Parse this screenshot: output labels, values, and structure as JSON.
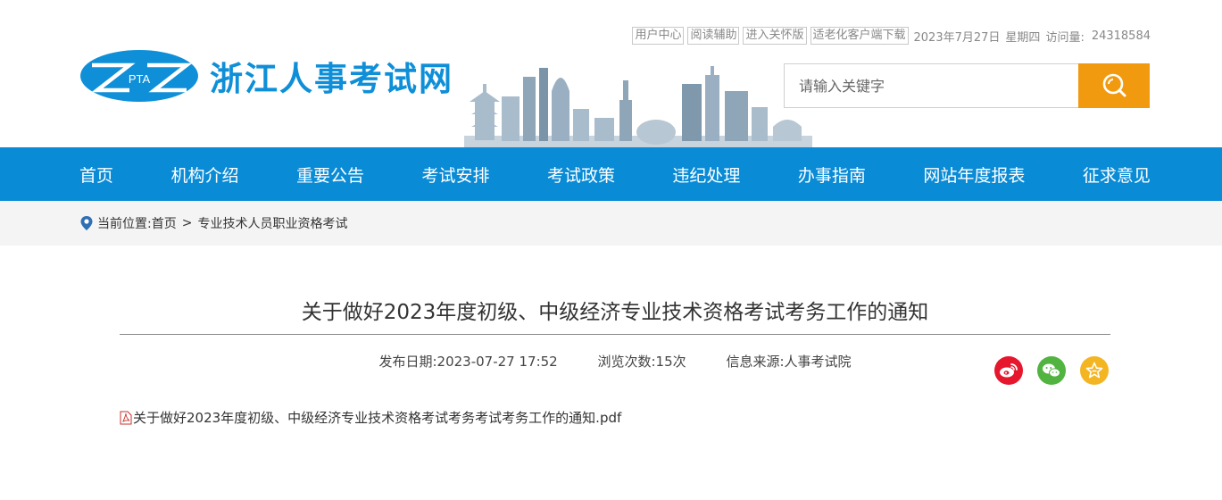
{
  "header": {
    "top_links": [
      "用户中心",
      "阅读辅助",
      "进入关怀版",
      "适老化客户端下载"
    ],
    "date": "2023年7月27日",
    "weekday": "星期四",
    "visit_label": "访问量:",
    "visit_count": "24318584",
    "logo_badge_text": "PTA",
    "site_title": "浙江人事考试网"
  },
  "search": {
    "placeholder": "请输入关键字"
  },
  "nav": {
    "items": [
      "首页",
      "机构介绍",
      "重要公告",
      "考试安排",
      "考试政策",
      "违纪处理",
      "办事指南",
      "网站年度报表",
      "征求意见"
    ]
  },
  "breadcrumb": {
    "label": "当前位置:",
    "home": "首页",
    "separator": ">",
    "current": "专业技术人员职业资格考试"
  },
  "article": {
    "title": "关于做好2023年度初级、中级经济专业技术资格考试考务工作的通知",
    "publish_date": "发布日期:2023-07-27 17:52",
    "views": "浏览次数:15次",
    "source": "信息来源:人事考试院",
    "attachment": "关于做好2023年度初级、中级经济专业技术资格考试考务考试考务工作的通知.pdf"
  },
  "colors": {
    "brand_blue": "#0a8bd6",
    "search_orange": "#f19a10",
    "weibo_red": "#e6162d",
    "wechat_green": "#51b340",
    "fav_yellow": "#f4b523"
  }
}
